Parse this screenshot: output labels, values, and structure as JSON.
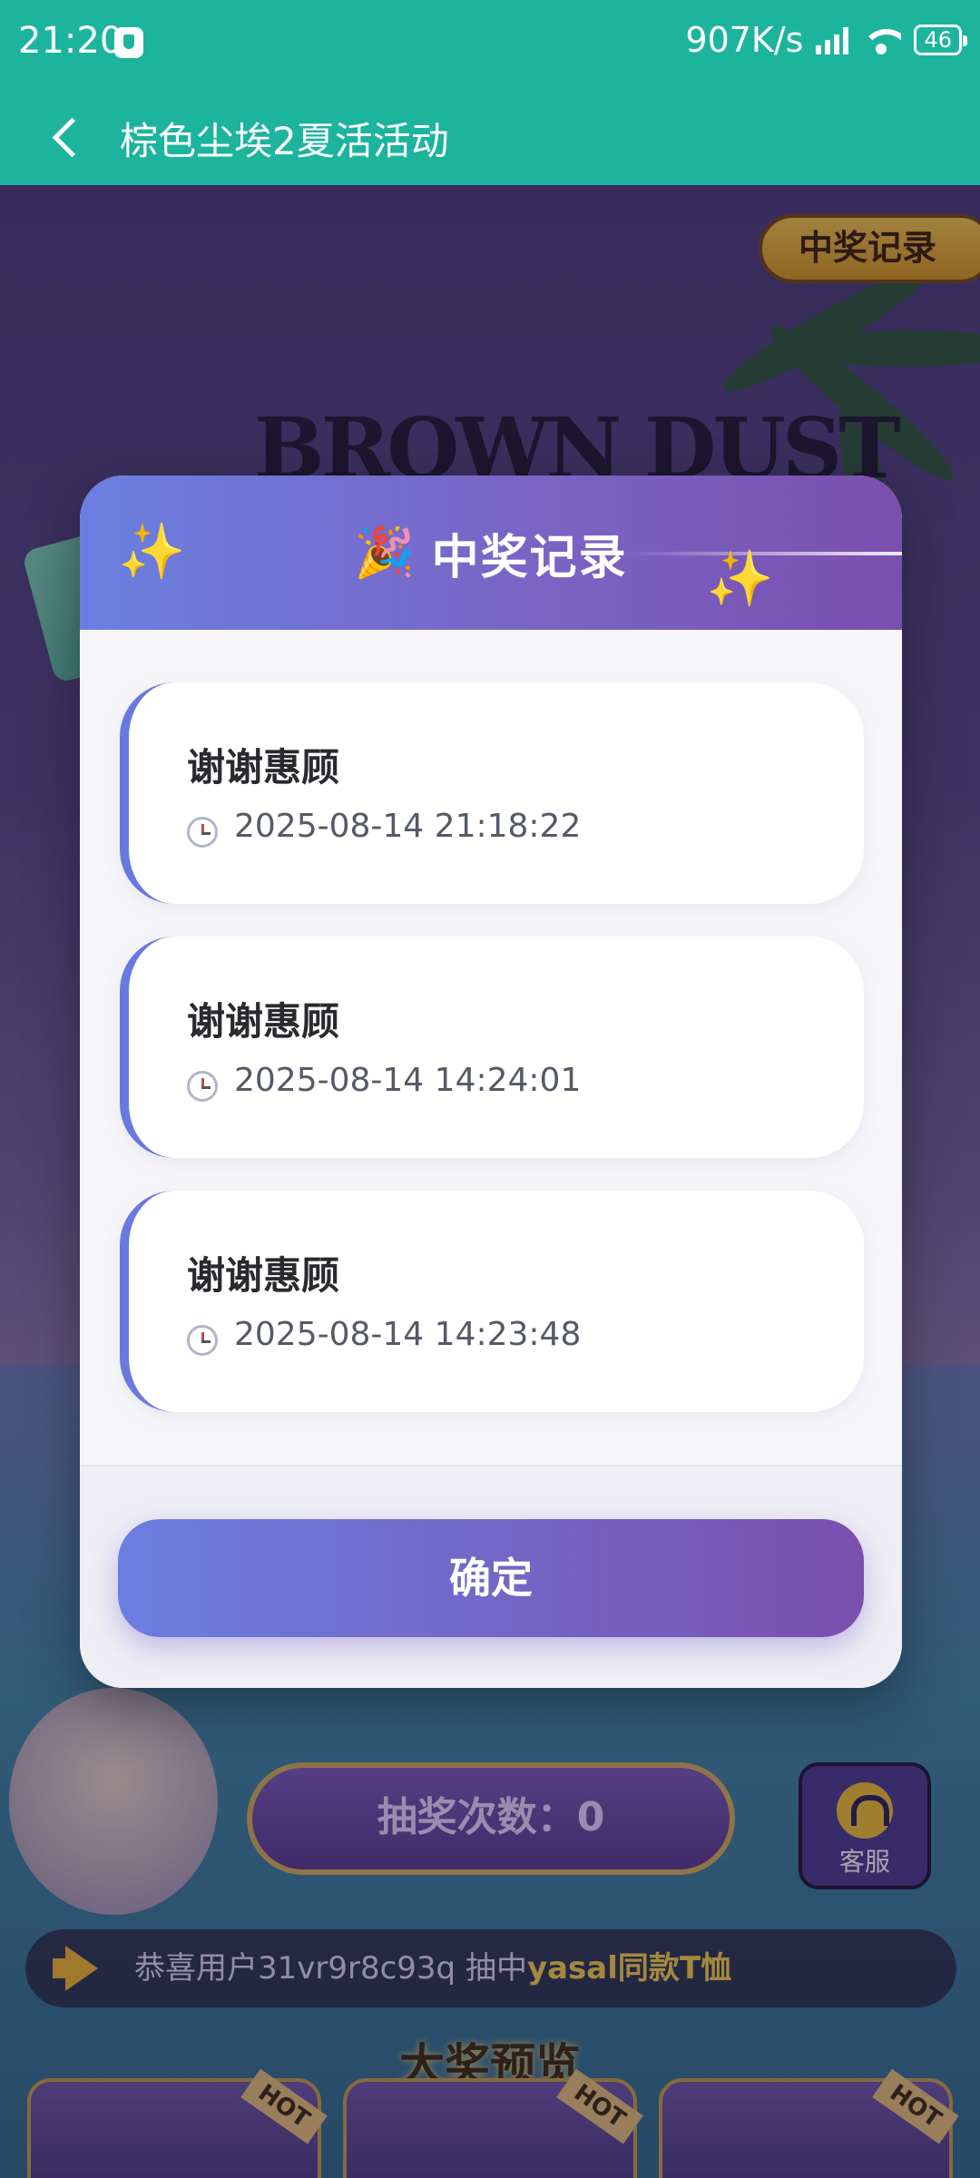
{
  "status_bar": {
    "time": "21:20",
    "network_speed": "907K/s",
    "battery": "46"
  },
  "header": {
    "title": "棕色尘埃2夏活活动"
  },
  "background": {
    "records_button": "中奖记录",
    "logo_text": "BROWN DUST II",
    "draw_count_label": "抽奖次数：",
    "draw_count_value": "0",
    "service_label": "客服",
    "marquee_prefix": "恭喜用户31vr9r8c93q 抽中",
    "marquee_prize": "yasal同款T恤",
    "preview_title": "大奖预览",
    "hot_tags": [
      "HOT",
      "HOT",
      "HOT"
    ]
  },
  "modal": {
    "title": "中奖记录",
    "records": [
      {
        "name": "谢谢惠顾",
        "time": "2025-08-14 21:18:22"
      },
      {
        "name": "谢谢惠顾",
        "time": "2025-08-14 14:24:01"
      },
      {
        "name": "谢谢惠顾",
        "time": "2025-08-14 14:23:48"
      }
    ],
    "confirm_label": "确定"
  },
  "colors": {
    "app_bar": "#1db49e",
    "modal_gradient_start": "#6b7fe0",
    "modal_gradient_end": "#7b4fae",
    "accent_gold": "#f3b930"
  }
}
